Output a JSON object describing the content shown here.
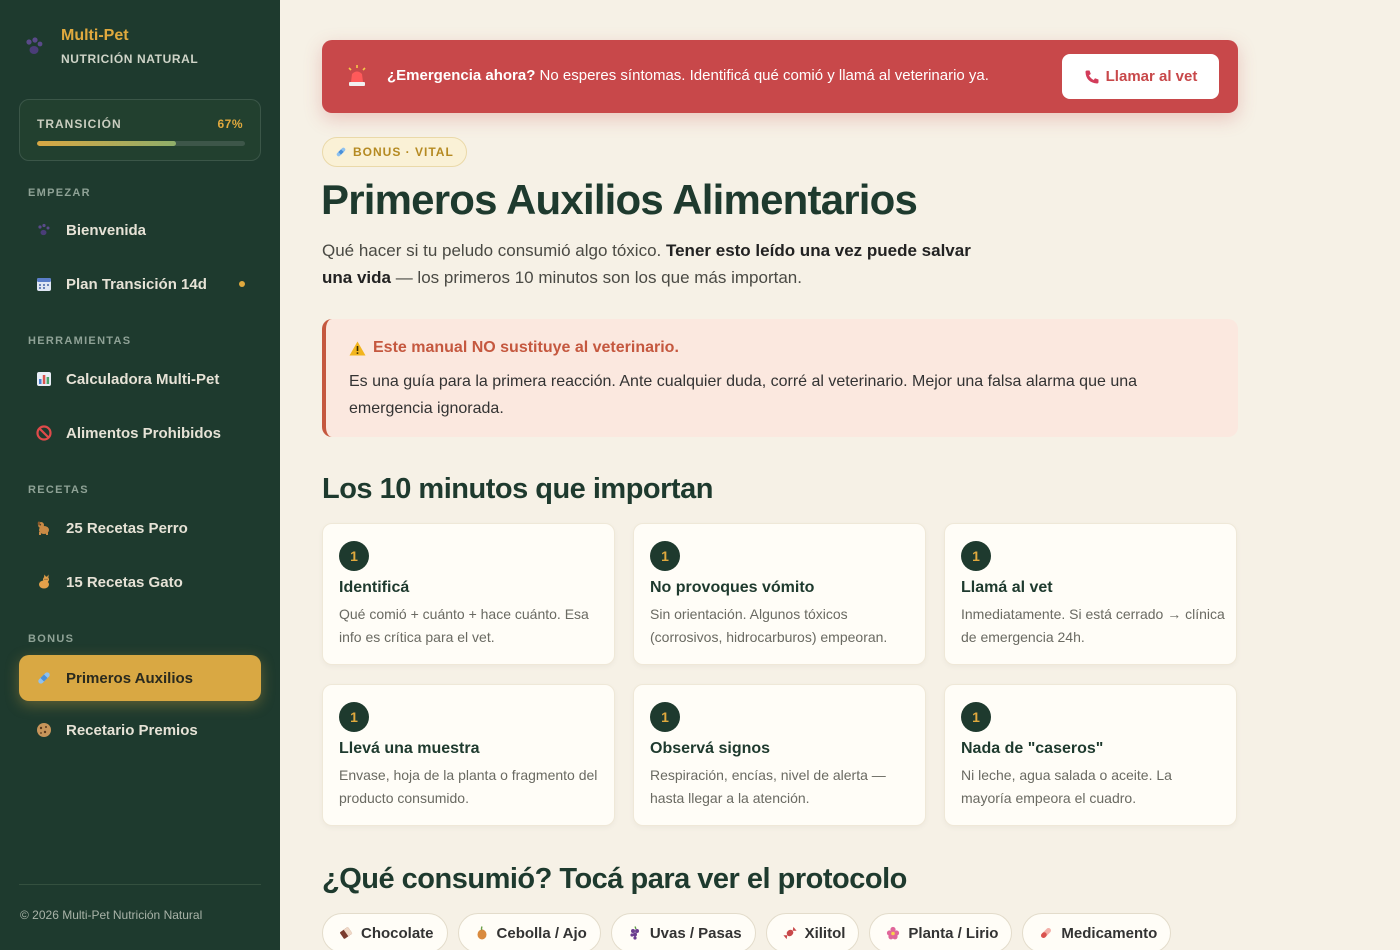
{
  "brand": {
    "name": "Multi-Pet",
    "subtitle": "NUTRICIÓN NATURAL"
  },
  "progress": {
    "label": "TRANSICIÓN",
    "percent_text": "67%",
    "value": 0.67
  },
  "sidebar": {
    "sections": [
      {
        "label": "EMPEZAR"
      },
      {
        "label": "HERRAMIENTAS"
      },
      {
        "label": "RECETAS"
      },
      {
        "label": "BONUS"
      }
    ],
    "items": [
      {
        "label": "Bienvenida",
        "icon": "paw-icon"
      },
      {
        "label": "Plan Transición 14d",
        "icon": "calendar-icon"
      },
      {
        "label": "Calculadora Multi-Pet",
        "icon": "chart-icon"
      },
      {
        "label": "Alimentos Prohibidos",
        "icon": "prohibited-icon"
      },
      {
        "label": "25 Recetas Perro",
        "icon": "dog-icon"
      },
      {
        "label": "15 Recetas Gato",
        "icon": "cat-icon"
      },
      {
        "label": "Primeros Auxilios",
        "icon": "bandage-icon"
      },
      {
        "label": "Recetario Premios",
        "icon": "cookie-icon"
      }
    ],
    "footer": "© 2026 Multi-Pet Nutrición Natural"
  },
  "emergency": {
    "bold": "¿Emergencia ahora?",
    "text": " No esperes síntomas. Identificá qué comió y llamá al veterinario ya.",
    "button": "Llamar al vet",
    "color": "#c8484a"
  },
  "badge": "BONUS · VITAL",
  "title": "Primeros Auxilios Alimentarios",
  "intro": {
    "part1": "Qué hacer si tu peludo consumió algo tóxico. ",
    "bold": "Tener esto leído una vez puede salvar una vida",
    "part2": " — los primeros 10 minutos son los que más importan."
  },
  "warning": {
    "title": "Este manual NO sustituye al veterinario.",
    "body": "Es una guía para la primera reacción. Ante cualquier duda, corré al veterinario. Mejor una falsa alarma que una emergencia ignorada."
  },
  "steps_section": "Los 10 minutos que importan",
  "steps": [
    {
      "num": "1",
      "title": "Identificá",
      "desc": "Qué comió + cuánto + hace cuánto. Esa info es crítica para el vet."
    },
    {
      "num": "1",
      "title": "No provoques vómito",
      "desc": "Sin orientación. Algunos tóxicos (corrosivos, hidrocarburos) empeoran."
    },
    {
      "num": "1",
      "title": "Llamá al vet",
      "desc": "Inmediatamente. Si está cerrado → clínica de emergencia 24h."
    },
    {
      "num": "1",
      "title": "Llevá una muestra",
      "desc": "Envase, hoja de la planta o fragmento del producto consumido."
    },
    {
      "num": "1",
      "title": "Observá signos",
      "desc": "Respiración, encías, nivel de alerta — hasta llegar a la atención."
    },
    {
      "num": "1",
      "title": "Nada de \"caseros\"",
      "desc": "Ni leche, agua salada o aceite. La mayoría empeora el cuadro."
    }
  ],
  "protocol_section": "¿Qué consumió? Tocá para ver el protocolo",
  "chips": [
    {
      "label": "Chocolate",
      "icon": "chocolate-icon",
      "color": "#7a3b2e"
    },
    {
      "label": "Cebolla / Ajo",
      "icon": "onion-icon",
      "color": "#c9823a"
    },
    {
      "label": "Uvas / Pasas",
      "icon": "grapes-icon",
      "color": "#6a3d8f"
    },
    {
      "label": "Xilitol",
      "icon": "candy-icon",
      "color": "#c8484a"
    },
    {
      "label": "Planta / Lirio",
      "icon": "flower-icon",
      "color": "#e0669a"
    },
    {
      "label": "Medicamento",
      "icon": "pill-icon",
      "color": "#d9534f"
    }
  ]
}
